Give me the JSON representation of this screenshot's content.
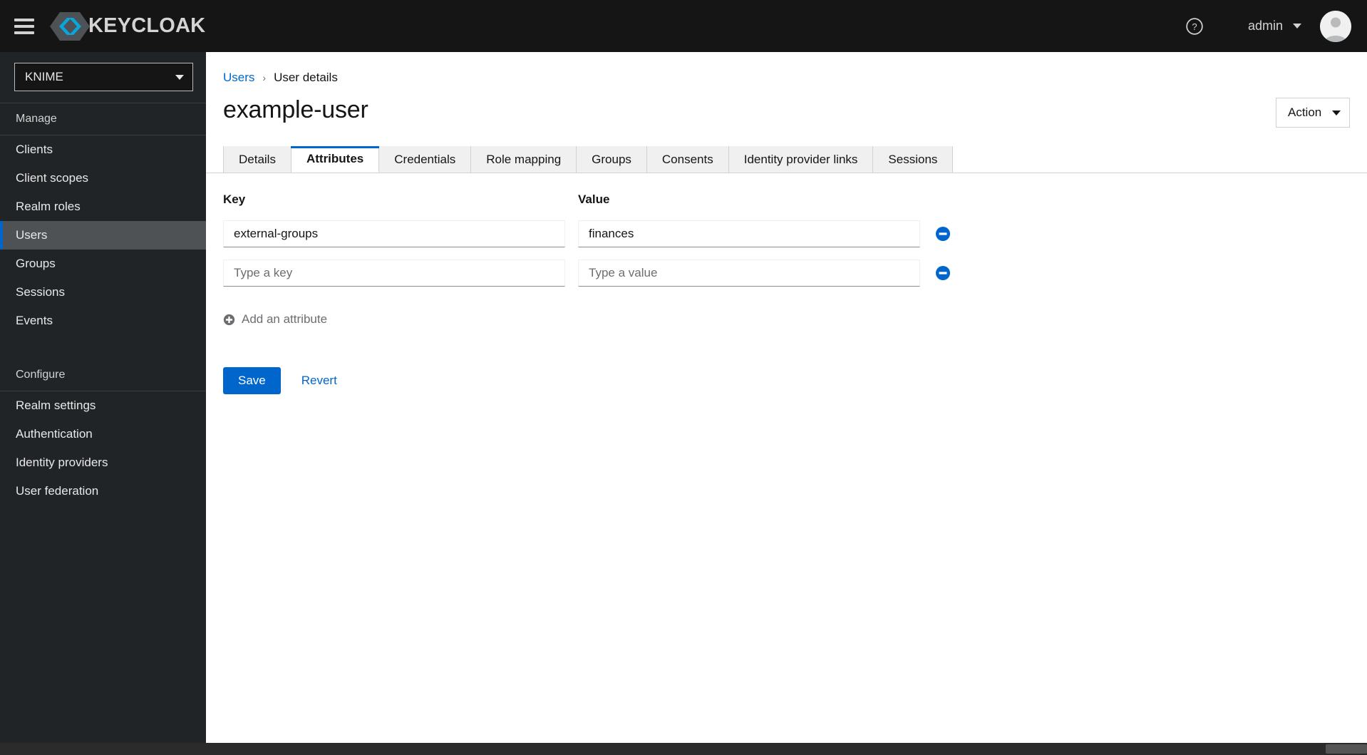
{
  "masthead": {
    "menu_toggle_label": "Global navigation",
    "brand_text": "KEYCLOAK",
    "help_icon": "question-circle-icon",
    "user_name": "admin",
    "avatar_icon": "user-avatar-icon"
  },
  "sidebar": {
    "realm_selector": {
      "value": "KNIME",
      "caret_icon": "caret-down-icon"
    },
    "groups": [
      {
        "title": "Manage",
        "items": [
          {
            "label": "Clients",
            "active": false
          },
          {
            "label": "Client scopes",
            "active": false
          },
          {
            "label": "Realm roles",
            "active": false
          },
          {
            "label": "Users",
            "active": true
          },
          {
            "label": "Groups",
            "active": false
          },
          {
            "label": "Sessions",
            "active": false
          },
          {
            "label": "Events",
            "active": false
          }
        ]
      },
      {
        "title": "Configure",
        "items": [
          {
            "label": "Realm settings",
            "active": false
          },
          {
            "label": "Authentication",
            "active": false
          },
          {
            "label": "Identity providers",
            "active": false
          },
          {
            "label": "User federation",
            "active": false
          }
        ]
      }
    ]
  },
  "content": {
    "breadcrumb": {
      "parent": "Users",
      "separator": "›",
      "current": "User details"
    },
    "page_title": "example-user",
    "action_dropdown": {
      "label": "Action",
      "caret_icon": "caret-down-icon"
    },
    "tabs": [
      {
        "label": "Details",
        "active": false
      },
      {
        "label": "Attributes",
        "active": true
      },
      {
        "label": "Credentials",
        "active": false
      },
      {
        "label": "Role mapping",
        "active": false
      },
      {
        "label": "Groups",
        "active": false
      },
      {
        "label": "Consents",
        "active": false
      },
      {
        "label": "Identity provider links",
        "active": false
      },
      {
        "label": "Sessions",
        "active": false
      }
    ],
    "attributes_form": {
      "column_headers": {
        "key": "Key",
        "value": "Value"
      },
      "rows": [
        {
          "key_value": "external-groups",
          "key_placeholder": "Type a key",
          "value_value": "finances",
          "value_placeholder": "Type a value",
          "remove_icon": "minus-circle-icon"
        },
        {
          "key_value": "",
          "key_placeholder": "Type a key",
          "value_value": "",
          "value_placeholder": "Type a value",
          "remove_icon": "minus-circle-icon"
        }
      ],
      "add_attribute": {
        "label": "Add an attribute",
        "icon": "plus-circle-icon"
      },
      "save_label": "Save",
      "revert_label": "Revert"
    }
  },
  "colors": {
    "brand_accent": "#0891cc",
    "primary_blue": "#0066cc",
    "masthead_bg": "#151515",
    "sidebar_bg": "#212427",
    "sidebar_active_bg": "#4f5255",
    "content_bg": "#ffffff",
    "tab_inactive_bg": "#f0f0f0",
    "muted_text": "#6a6e73"
  }
}
